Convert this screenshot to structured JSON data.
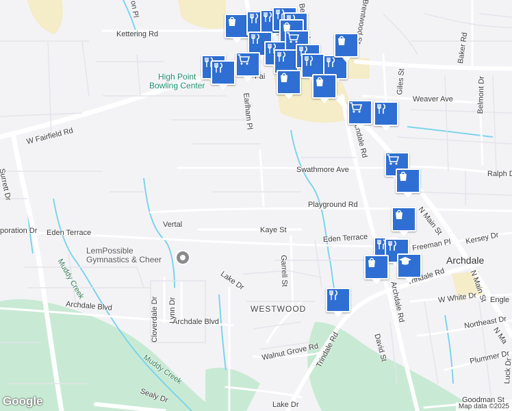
{
  "map": {
    "attribution": "Map data ©2025",
    "logo": "Google",
    "colors": {
      "water": "#7dd3ec",
      "park": "#c8ead4",
      "urban": "#f5ecc8",
      "road": "#ffffff",
      "pin": "#2f6fd3"
    }
  },
  "labels": {
    "kettering": "Kettering Rd",
    "w_fairfield": "W Fairfield Rd",
    "surrett": "Surrett Dr",
    "earlham": "Earlham Pl",
    "swathmore": "Swathmore Ave",
    "playground": "Playground Rd",
    "vertal": "Vertal",
    "poration": "poration Dr",
    "eden_terrace_w": "Eden Terrace",
    "eden_terrace_e": "Eden Terrace",
    "kaye": "Kaye St",
    "garrell": "Garrell St",
    "lake_dr_n": "Lake Dr",
    "lake_dr_s": "Lake Dr",
    "westwood": "WESTWOOD",
    "archdale_blvd_w": "Archdale Blvd",
    "archdale_blvd_e": "Archdale Blvd",
    "cloverdale": "Cloverdale Dr",
    "lynn": "Lynn Dr",
    "walnut_grove": "Walnut Grove Rd",
    "trindale": "Trindale Rd",
    "trindale_e": "Trindale Rd",
    "archdale_rd_n": "Archdale Rd",
    "archdale_rd_s": "Archdale Rd",
    "sealy": "Sealy Dr",
    "david": "David St",
    "n_main_n": "N Main St",
    "n_main_s": "N Main St",
    "n_main_e": "N Ma",
    "weaver": "Weaver Ave",
    "giles": "Giles St",
    "baker": "Baker Rd",
    "belmont": "Belmont Dr",
    "ralph": "Ralph D",
    "freeman": "Freeman Pl",
    "kersey": "Kersey Dr",
    "archdale": "Archdale",
    "w_white": "W White Dr",
    "engle": "Engle",
    "northeast": "Northeast Dr",
    "plummer": "Plummer Dr",
    "luck": "Luck Dr",
    "goodman": "Goodman St",
    "muddy_creek_n": "Muddy Creek",
    "muddy_creek_s": "Muddy Creek",
    "bowling": "High Point\nBowling Center",
    "gym": "LemPossible\nGymnastics & Cheer",
    "ion_pl": "on Pl",
    "bellemeade": "Bellemead",
    "brentwood": "Brentwood St",
    "fairfield_short": "Fai",
    "pl_short": "Pl"
  },
  "pins": [
    {
      "icon": "shopping-bag-icon"
    },
    {
      "icon": "restaurant-icon"
    },
    {
      "icon": "restaurant-icon"
    },
    {
      "icon": "restaurant-icon"
    },
    {
      "icon": "restaurant-icon"
    },
    {
      "icon": "restaurant-icon"
    },
    {
      "icon": "shopping-cart-icon"
    },
    {
      "icon": "shopping-bag-icon"
    },
    {
      "icon": "restaurant-icon"
    },
    {
      "icon": "shopping-cart-icon"
    },
    {
      "icon": "restaurant-icon"
    },
    {
      "icon": "restaurant-icon"
    },
    {
      "icon": "restaurant-icon"
    },
    {
      "icon": "restaurant-icon"
    },
    {
      "icon": "shopping-bag-icon"
    },
    {
      "icon": "restaurant-icon"
    },
    {
      "icon": "restaurant-icon"
    },
    {
      "icon": "shopping-bag-icon"
    },
    {
      "icon": "shopping-bag-icon"
    },
    {
      "icon": "shopping-cart-icon"
    },
    {
      "icon": "restaurant-icon"
    },
    {
      "icon": "shopping-cart-icon"
    },
    {
      "icon": "shopping-bag-icon"
    },
    {
      "icon": "shopping-bag-icon"
    },
    {
      "icon": "restaurant-icon"
    },
    {
      "icon": "restaurant-icon"
    },
    {
      "icon": "shopping-bag-icon"
    },
    {
      "icon": "school-icon"
    },
    {
      "icon": "restaurant-icon"
    }
  ]
}
